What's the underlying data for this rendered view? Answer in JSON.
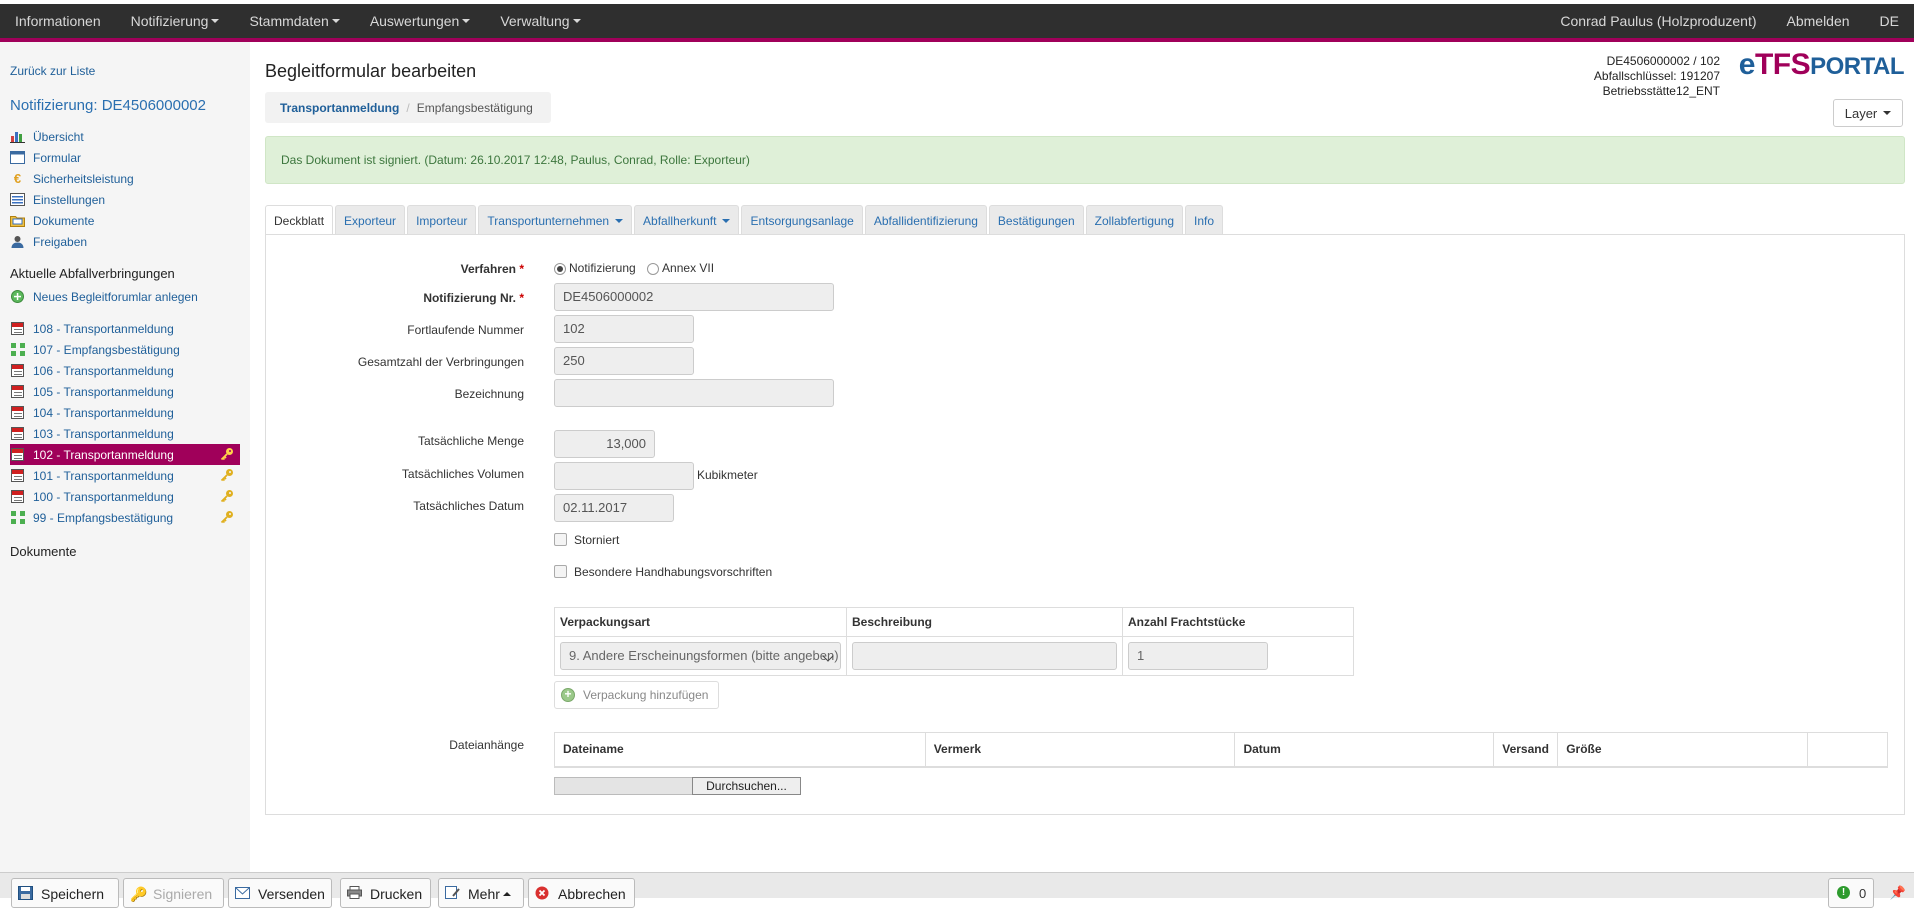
{
  "topnav": {
    "left": [
      {
        "label": "Informationen",
        "caret": false
      },
      {
        "label": "Notifizierung",
        "caret": true
      },
      {
        "label": "Stammdaten",
        "caret": true
      },
      {
        "label": "Auswertungen",
        "caret": true
      },
      {
        "label": "Verwaltung",
        "caret": true
      }
    ],
    "user": "Conrad Paulus (Holzproduzent)",
    "logout": "Abmelden",
    "lang": "DE"
  },
  "sidebar": {
    "back": "Zurück zur Liste",
    "notification_title": "Notifizierung: DE4506000002",
    "menu": [
      "Übersicht",
      "Formular",
      "Sicherheitsleistung",
      "Einstellungen",
      "Dokumente",
      "Freigaben"
    ],
    "section_shipments": "Aktuelle Abfallverbringungen",
    "new_form": "Neues Begleitforumlar anlegen",
    "shipments": [
      {
        "label": "108 - Transportanmeldung",
        "type": "cal",
        "key": false,
        "active": false
      },
      {
        "label": "107 - Empfangsbestätigung",
        "type": "arrows",
        "key": false,
        "active": false
      },
      {
        "label": "106 - Transportanmeldung",
        "type": "cal",
        "key": false,
        "active": false
      },
      {
        "label": "105 - Transportanmeldung",
        "type": "cal",
        "key": false,
        "active": false
      },
      {
        "label": "104 - Transportanmeldung",
        "type": "cal",
        "key": false,
        "active": false
      },
      {
        "label": "103 - Transportanmeldung",
        "type": "cal",
        "key": false,
        "active": false
      },
      {
        "label": "102 - Transportanmeldung",
        "type": "cal",
        "key": true,
        "active": true
      },
      {
        "label": "101 - Transportanmeldung",
        "type": "cal",
        "key": true,
        "active": false
      },
      {
        "label": "100 - Transportanmeldung",
        "type": "cal",
        "key": true,
        "active": false
      },
      {
        "label": "99 - Empfangsbestätigung",
        "type": "arrows",
        "key": true,
        "active": false
      }
    ],
    "section_documents": "Dokumente"
  },
  "header": {
    "title": "Begleitformular bearbeiten",
    "breadcrumb_active": "Transportanmeldung",
    "breadcrumb_current": "Empfangsbestätigung",
    "info_line1": "DE4506000002 / 102",
    "info_line2": "Abfallschlüssel: 191207",
    "info_line3": "Betriebsstätte12_ENT",
    "logo_e": "e",
    "logo_tfs": "TFS",
    "logo_portal": "PORTAL",
    "layer_label": "Layer"
  },
  "alert": "Das Dokument ist signiert. (Datum: 26.10.2017 12:48, Paulus, Conrad, Rolle: Exporteur)",
  "tabs": [
    {
      "label": "Deckblatt",
      "active": true,
      "caret": false
    },
    {
      "label": "Exporteur",
      "active": false,
      "caret": false
    },
    {
      "label": "Importeur",
      "active": false,
      "caret": false
    },
    {
      "label": "Transportunternehmen",
      "active": false,
      "caret": true
    },
    {
      "label": "Abfallherkunft",
      "active": false,
      "caret": true
    },
    {
      "label": "Entsorgungsanlage",
      "active": false,
      "caret": false
    },
    {
      "label": "Abfallidentifizierung",
      "active": false,
      "caret": false
    },
    {
      "label": "Bestätigungen",
      "active": false,
      "caret": false
    },
    {
      "label": "Zollabfertigung",
      "active": false,
      "caret": false
    },
    {
      "label": "Info",
      "active": false,
      "caret": false
    }
  ],
  "form": {
    "verfahren_label": "Verfahren",
    "verfahren_opt1": "Notifizierung",
    "verfahren_opt2": "Annex VII",
    "notif_nr_label": "Notifizierung Nr.",
    "notif_nr_value": "DE4506000002",
    "fortl_label": "Fortlaufende Nummer",
    "fortl_value": "102",
    "gesamt_label": "Gesamtzahl der Verbringungen",
    "gesamt_value": "250",
    "bezeichnung_label": "Bezeichnung",
    "bezeichnung_value": "",
    "menge_label": "Tatsächliche Menge",
    "menge_value": "13,000",
    "volumen_label": "Tatsächliches Volumen",
    "volumen_value": "",
    "volumen_unit": "Kubikmeter",
    "datum_label": "Tatsächliches Datum",
    "datum_value": "02.11.2017",
    "storniert_label": "Storniert",
    "handhabung_label": "Besondere Handhabungsvorschriften",
    "required_marker": "*"
  },
  "packaging": {
    "headers": [
      "Verpackungsart",
      "Beschreibung",
      "Anzahl Frachtstücke"
    ],
    "row": {
      "art": "9. Andere Erscheinungsformen (bitte angeben)",
      "beschreibung": "",
      "anzahl": "1"
    },
    "add_label": "Verpackung hinzufügen"
  },
  "attachments": {
    "label": "Dateianhänge",
    "headers": [
      "Dateiname",
      "Vermerk",
      "Datum",
      "Versand",
      "Größe",
      ""
    ],
    "browse": "Durchsuchen..."
  },
  "toolbar": {
    "save": "Speichern",
    "sign": "Signieren",
    "send": "Versenden",
    "print": "Drucken",
    "more": "Mehr",
    "cancel": "Abbrechen",
    "status_count": "0"
  }
}
